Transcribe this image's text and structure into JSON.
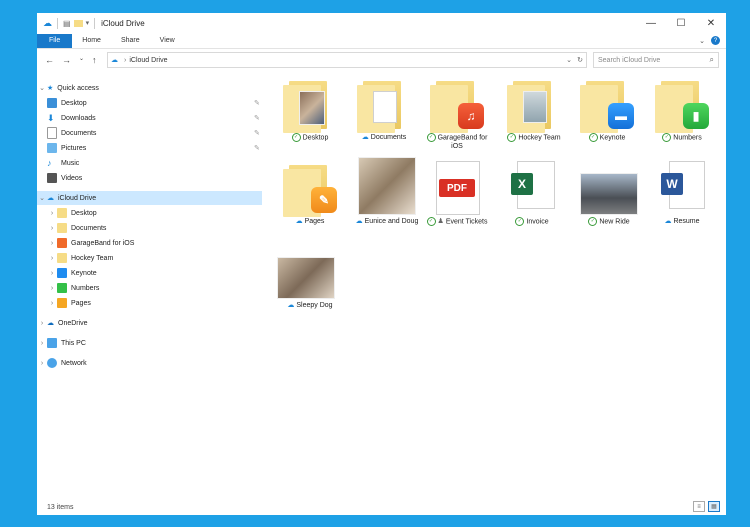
{
  "window": {
    "title": "iCloud Drive"
  },
  "ribbon": {
    "tabs": [
      "File",
      "Home",
      "Share",
      "View"
    ]
  },
  "address": {
    "location": "iCloud Drive",
    "search_placeholder": "Search iCloud Drive"
  },
  "nav": {
    "quick_access": {
      "label": "Quick access",
      "items": [
        {
          "label": "Desktop"
        },
        {
          "label": "Downloads"
        },
        {
          "label": "Documents"
        },
        {
          "label": "Pictures"
        },
        {
          "label": "Music"
        },
        {
          "label": "Videos"
        }
      ]
    },
    "icloud": {
      "label": "iCloud Drive",
      "items": [
        {
          "label": "Desktop"
        },
        {
          "label": "Documents"
        },
        {
          "label": "GarageBand for iOS"
        },
        {
          "label": "Hockey Team"
        },
        {
          "label": "Keynote"
        },
        {
          "label": "Numbers"
        },
        {
          "label": "Pages"
        }
      ]
    },
    "onedrive": {
      "label": "OneDrive"
    },
    "thispc": {
      "label": "This PC"
    },
    "network": {
      "label": "Network"
    }
  },
  "files": [
    {
      "name": "Desktop",
      "status": "synced"
    },
    {
      "name": "Documents",
      "status": "cloud"
    },
    {
      "name": "GarageBand for iOS",
      "status": "synced"
    },
    {
      "name": "Hockey Team",
      "status": "synced"
    },
    {
      "name": "Keynote",
      "status": "synced"
    },
    {
      "name": "Numbers",
      "status": "synced"
    },
    {
      "name": "Pages",
      "status": "cloud"
    },
    {
      "name": "Eunice and Doug",
      "status": "cloud"
    },
    {
      "name": "Event Tickets",
      "status": "shared"
    },
    {
      "name": "Invoice",
      "status": "synced"
    },
    {
      "name": "New Ride",
      "status": "synced"
    },
    {
      "name": "Resume",
      "status": "cloud"
    },
    {
      "name": "Sleepy Dog",
      "status": "cloud"
    }
  ],
  "badges": {
    "pdf": "PDF",
    "excel": "X",
    "word": "W"
  },
  "status_bar": {
    "item_count": "13 items"
  },
  "colors": {
    "accent": "#1979ca",
    "desktop_bg": "#1ea1e6",
    "folder": "#f6dc86"
  }
}
